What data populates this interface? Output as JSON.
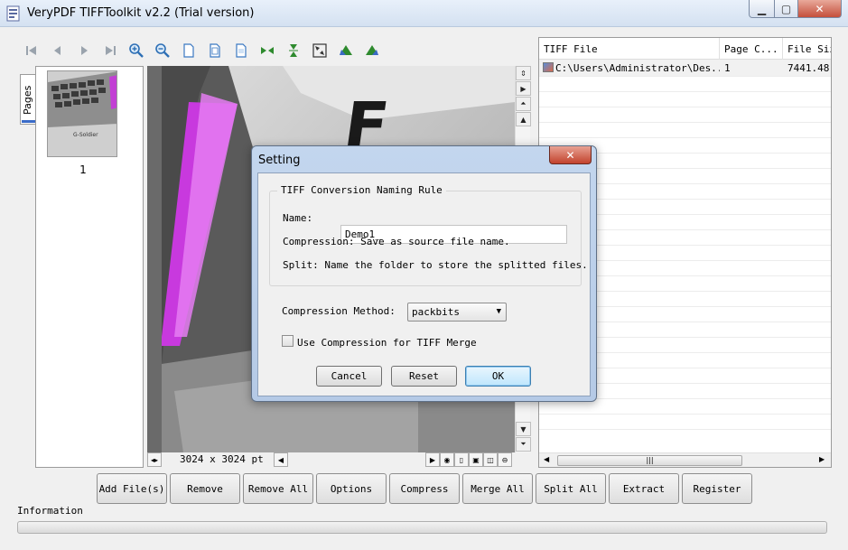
{
  "window": {
    "title": "VeryPDF TIFFToolkit v2.2 (Trial version)",
    "minimize": "▁",
    "maximize": "▢",
    "close": "✕"
  },
  "toolbar": {
    "icons": [
      "first-page-icon",
      "prev-page-icon",
      "next-page-icon",
      "last-page-icon",
      "zoom-in-icon",
      "zoom-out-icon",
      "actual-size-icon",
      "fit-width-icon",
      "fit-page-icon",
      "flip-horizontal-icon",
      "flip-vertical-icon",
      "rotate-icon",
      "rotate-left-icon",
      "rotate-right-icon"
    ]
  },
  "pages_panel": {
    "tab_label": "Pages",
    "thumbnail_number": "1",
    "thumbnail_caption": "G-Soldier"
  },
  "viewer": {
    "key_letter": "F",
    "dimensions": "3024 x 3024 pt"
  },
  "file_list": {
    "columns": [
      "TIFF File",
      "Page C...",
      "File Siz"
    ],
    "rows": [
      {
        "path": "C:\\Users\\Administrator\\Des...",
        "pages": "1",
        "size": "7441.48"
      }
    ]
  },
  "actions": {
    "add_files": "Add File(s)",
    "remove": "Remove",
    "remove_all": "Remove All",
    "options": "Options",
    "compress": "Compress",
    "merge_all": "Merge All",
    "split_all": "Split All",
    "extract": "Extract",
    "register": "Register"
  },
  "status": {
    "information_label": "Information",
    "progress": 0
  },
  "dialog": {
    "title": "Setting",
    "close": "✕",
    "group_title": "TIFF Conversion Naming Rule",
    "name_label": "Name:",
    "name_value": "Demo1_",
    "compression_note": "Compression: Save as source file name.",
    "split_note": "Split: Name the folder to store the splitted files.",
    "method_label": "Compression Method:",
    "method_value": "packbits",
    "merge_check_label": "Use Compression for TIFF Merge",
    "merge_checked": false,
    "cancel": "Cancel",
    "reset": "Reset",
    "ok": "OK"
  }
}
